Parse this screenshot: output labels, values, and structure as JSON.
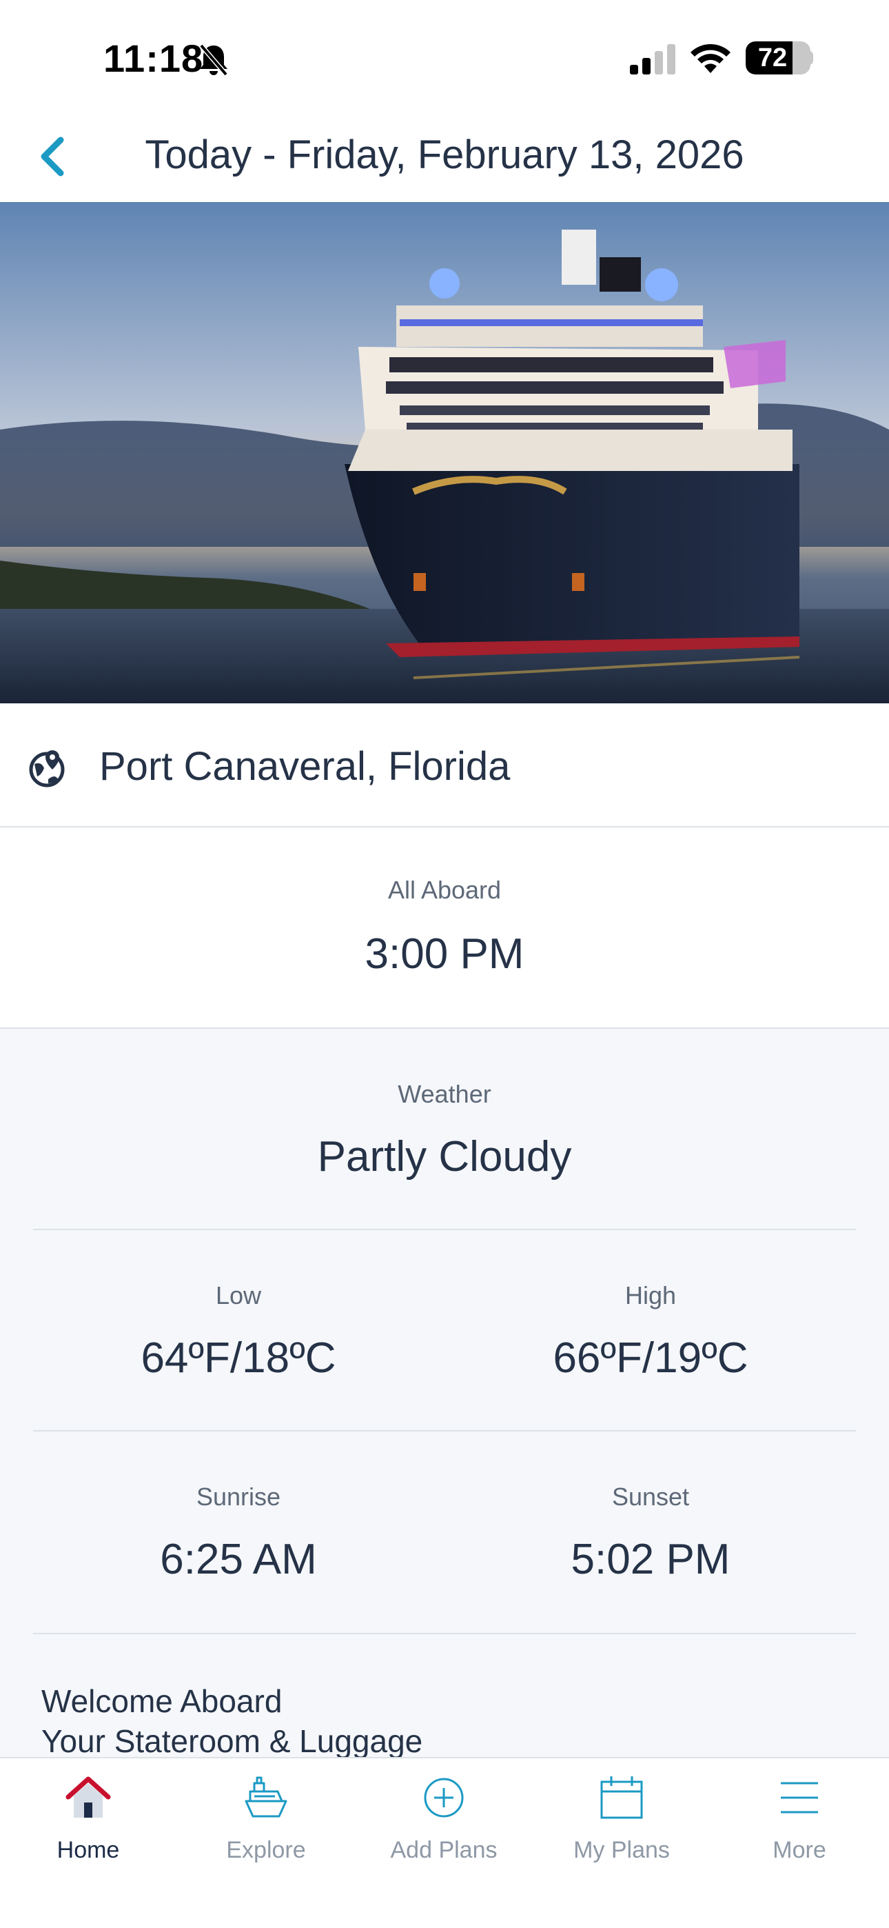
{
  "status_bar": {
    "time": "11:18",
    "battery": "72",
    "battery_level": 0.72
  },
  "header": {
    "title": "Today - Friday, February 13, 2026",
    "back_icon": "chevron-left-icon"
  },
  "port": {
    "name": "Port Canaveral, Florida",
    "icon": "globe-pin-icon"
  },
  "all_aboard": {
    "label": "All Aboard",
    "value": "3:00 PM"
  },
  "weather": {
    "label": "Weather",
    "condition": "Partly Cloudy",
    "low_label": "Low",
    "low_value": "64ºF/18ºC",
    "high_label": "High",
    "high_value": "66ºF/19ºC",
    "sunrise_label": "Sunrise",
    "sunrise_value": "6:25 AM",
    "sunset_label": "Sunset",
    "sunset_value": "5:02 PM"
  },
  "welcome": {
    "title": "Welcome Aboard",
    "subtitle": "Your Stateroom & Luggage"
  },
  "tabs": [
    {
      "label": "Home",
      "icon": "home-icon",
      "active": true
    },
    {
      "label": "Explore",
      "icon": "ship-icon",
      "active": false
    },
    {
      "label": "Add Plans",
      "icon": "plus-circle-icon",
      "active": false
    },
    {
      "label": "My Plans",
      "icon": "calendar-icon",
      "active": false
    },
    {
      "label": "More",
      "icon": "menu-icon",
      "active": false
    }
  ],
  "colors": {
    "accent": "#1b9ac4",
    "text": "#253247",
    "muted": "#8e98a5",
    "home_red": "#c8102e"
  }
}
